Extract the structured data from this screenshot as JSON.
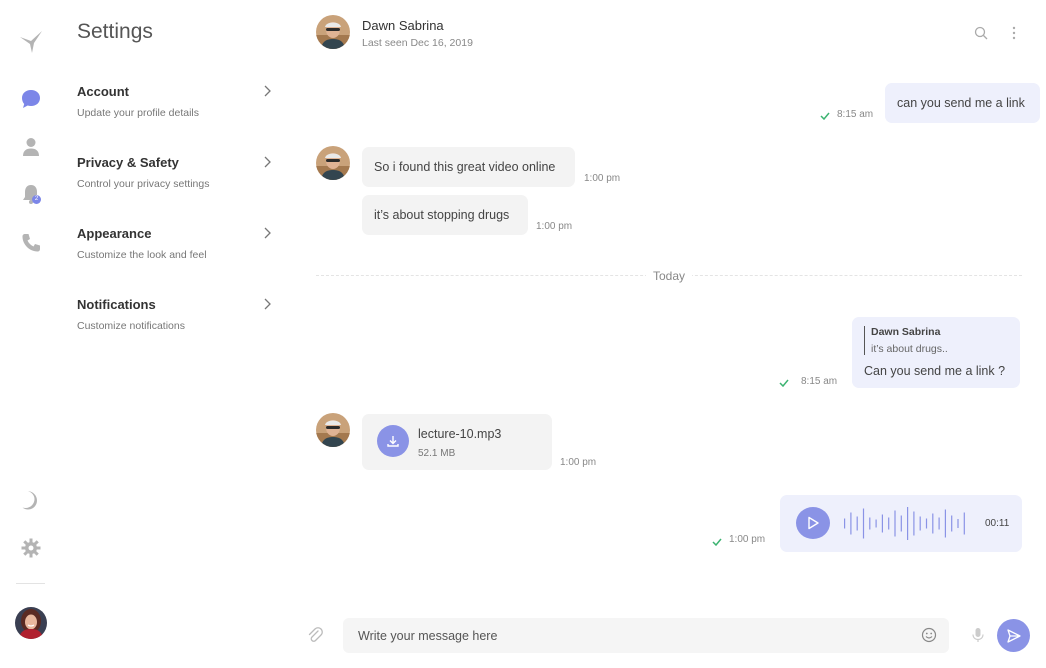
{
  "settings": {
    "title": "Settings",
    "items": [
      {
        "title": "Account",
        "subtitle": "Update your profile details"
      },
      {
        "title": "Privacy & Safety",
        "subtitle": "Control your privacy settings"
      },
      {
        "title": "Appearance",
        "subtitle": "Customize the look and feel"
      },
      {
        "title": "Notifications",
        "subtitle": "Customize notifications"
      }
    ]
  },
  "nav": {
    "notification_count": "2",
    "icons": [
      "logo-bird-icon",
      "chat-icon",
      "user-icon",
      "bell-icon",
      "phone-icon",
      "moon-icon",
      "gear-icon"
    ]
  },
  "chat": {
    "contact_name": "Dawn Sabrina",
    "last_seen": "Last seen Dec 16, 2019",
    "day_label": "Today",
    "messages": [
      {
        "text": "can you send me a link",
        "time": "8:15 am"
      },
      {
        "text": "So i found this great video online",
        "time": "1:00 pm"
      },
      {
        "text": "it’s about stopping drugs",
        "time": "1:00 pm"
      },
      {
        "reply_name": "Dawn Sabrina",
        "reply_text": "it’s about drugs..",
        "text": "Can you send me a link ?",
        "time": "8:15 am"
      },
      {
        "file_name": "lecture-10.mp3",
        "file_size": "52.1 MB",
        "time": "1:00 pm"
      },
      {
        "duration": "00:11",
        "time": "1:00 pm"
      }
    ]
  },
  "composer": {
    "placeholder": "Write your message here"
  },
  "colors": {
    "accent": "#8a93e6",
    "outgoing_bubble": "#eef0fc",
    "incoming_bubble": "#f3f3f3",
    "read_tick": "#3cb371"
  }
}
